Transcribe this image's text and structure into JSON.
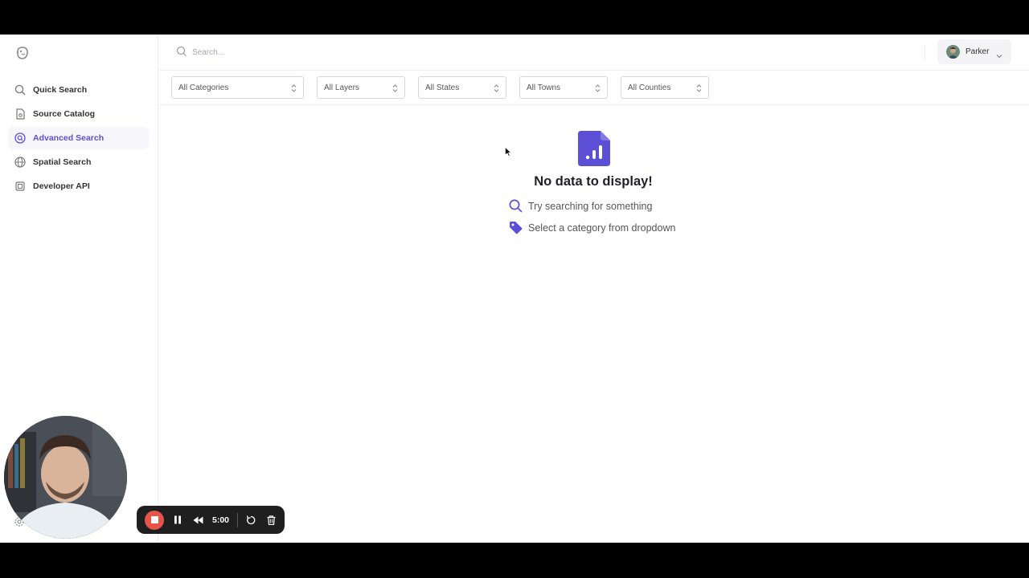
{
  "sidebar": {
    "items": [
      {
        "label": "Quick Search",
        "icon": "search-icon"
      },
      {
        "label": "Source Catalog",
        "icon": "document-icon"
      },
      {
        "label": "Advanced Search",
        "icon": "target-search-icon",
        "active": true
      },
      {
        "label": "Spatial Search",
        "icon": "globe-icon"
      },
      {
        "label": "Developer API",
        "icon": "chip-icon"
      }
    ]
  },
  "header": {
    "search_placeholder": "Search...",
    "user_name": "Parker"
  },
  "filters": [
    {
      "label": "All Categories"
    },
    {
      "label": "All Layers"
    },
    {
      "label": "All States"
    },
    {
      "label": "All Towns"
    },
    {
      "label": "All Counties"
    }
  ],
  "empty_state": {
    "title": "No data to display!",
    "hints": [
      {
        "text": "Try searching for something",
        "icon": "search-icon"
      },
      {
        "text": "Select a category from dropdown",
        "icon": "tag-icon"
      }
    ]
  },
  "recorder": {
    "time": "5:00"
  },
  "colors": {
    "accent": "#5b4fd6",
    "record_red": "#e6544a"
  }
}
